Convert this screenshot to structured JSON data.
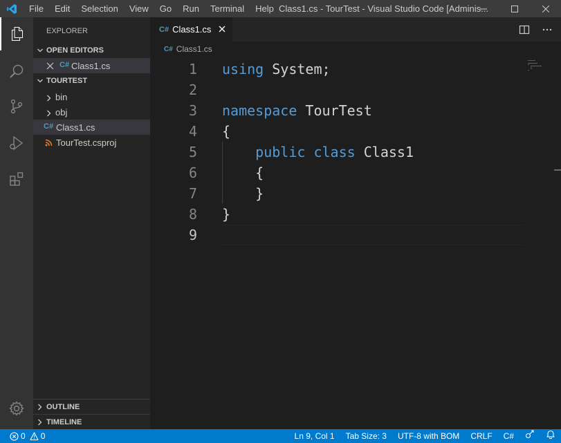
{
  "titlebar": {
    "logo_icon": "vscode-logo-icon",
    "menu": [
      "File",
      "Edit",
      "Selection",
      "View",
      "Go",
      "Run",
      "Terminal",
      "Help"
    ],
    "window_title": "Class1.cs - TourTest - Visual Studio Code [Adminis..."
  },
  "activitybar": {
    "items": [
      "explorer-icon",
      "search-icon",
      "source-control-icon",
      "run-debug-icon",
      "extensions-icon"
    ],
    "bottom": "manage-gear-icon"
  },
  "sidebar": {
    "title": "EXPLORER",
    "open_editors": {
      "label": "OPEN EDITORS",
      "items": [
        {
          "name": "Class1.cs",
          "icon": "csharp-icon"
        }
      ]
    },
    "project": {
      "label": "TOURTEST",
      "items": [
        {
          "name": "bin",
          "type": "folder"
        },
        {
          "name": "obj",
          "type": "folder"
        },
        {
          "name": "Class1.cs",
          "type": "file",
          "icon": "csharp-icon"
        },
        {
          "name": "TourTest.csproj",
          "type": "file",
          "icon": "rss-icon"
        }
      ]
    },
    "outline_label": "OUTLINE",
    "timeline_label": "TIMELINE"
  },
  "editor": {
    "tab_label": "Class1.cs",
    "breadcrumb": "Class1.cs",
    "lines": [
      {
        "n": "1",
        "text": "using System;"
      },
      {
        "n": "2",
        "text": ""
      },
      {
        "n": "3",
        "text": "namespace TourTest"
      },
      {
        "n": "4",
        "text": "{"
      },
      {
        "n": "5",
        "text": "    public class Class1"
      },
      {
        "n": "6",
        "text": "    {"
      },
      {
        "n": "7",
        "text": "    }"
      },
      {
        "n": "8",
        "text": "}"
      },
      {
        "n": "9",
        "text": ""
      }
    ]
  },
  "statusbar": {
    "errors": "0",
    "warnings": "0",
    "position": "Ln 9, Col 1",
    "tab_size": "Tab Size: 3",
    "encoding": "UTF-8 with BOM",
    "eol": "CRLF",
    "language": "C#"
  },
  "colors": {
    "accent": "#007acc",
    "keyword": "#569cd6",
    "csharp_icon": "#519aba",
    "csproj_icon": "#e37933"
  }
}
